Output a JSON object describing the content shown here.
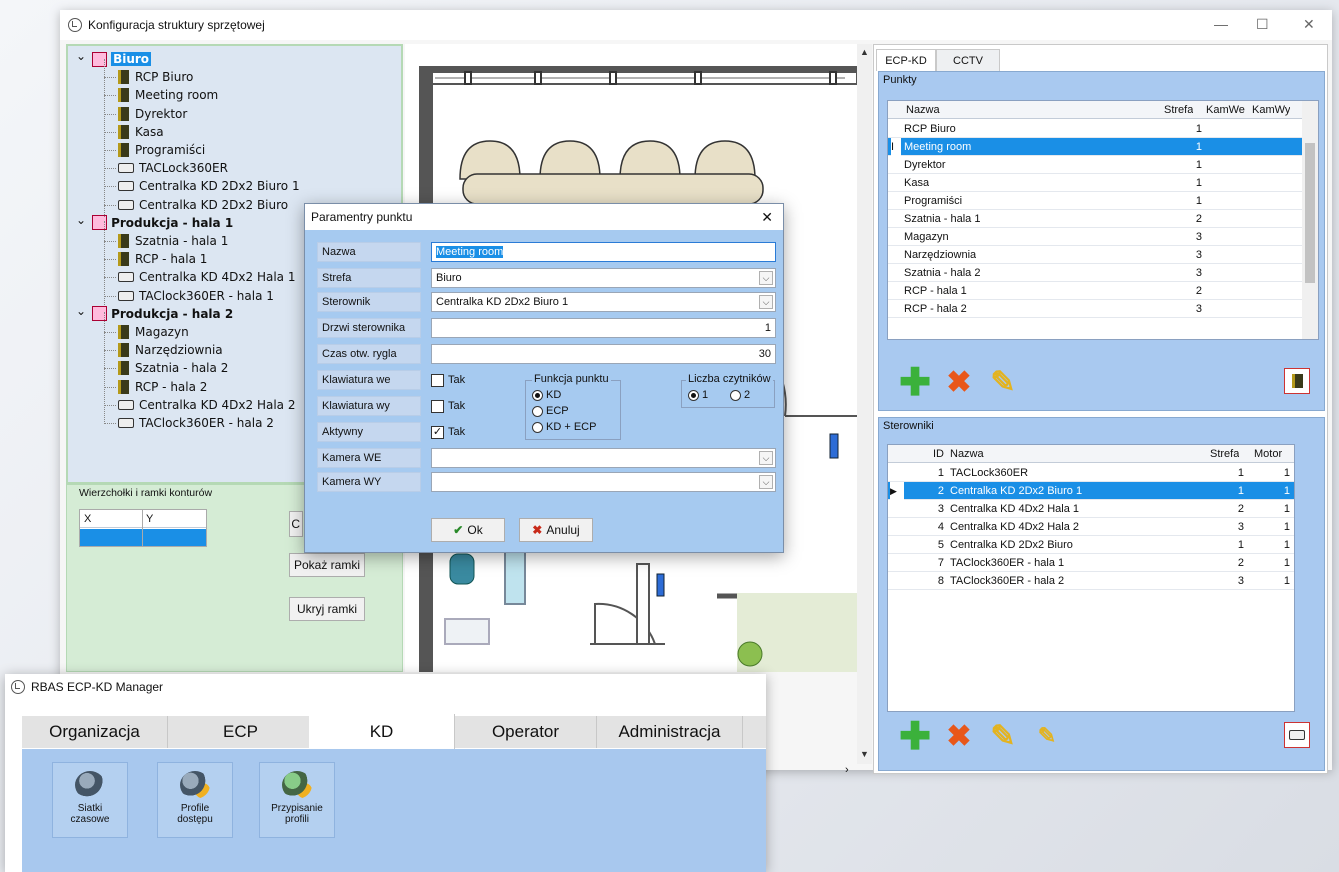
{
  "main_window": {
    "title": "Konfiguracja struktury sprzętowej",
    "min": "—",
    "max": "☐",
    "close": "✕"
  },
  "tree": [
    {
      "label": "Biuro",
      "type": "org",
      "level": 0,
      "selected": true
    },
    {
      "label": "RCP Biuro",
      "type": "door",
      "level": 1
    },
    {
      "label": "Meeting room",
      "type": "door",
      "level": 1
    },
    {
      "label": "Dyrektor",
      "type": "door",
      "level": 1
    },
    {
      "label": "Kasa",
      "type": "door",
      "level": 1
    },
    {
      "label": "Programiści",
      "type": "door",
      "level": 1
    },
    {
      "label": "TACLock360ER",
      "type": "dev",
      "level": 1
    },
    {
      "label": "Centralka KD 2Dx2 Biuro 1",
      "type": "dev",
      "level": 1
    },
    {
      "label": "Centralka KD 2Dx2 Biuro",
      "type": "dev",
      "level": 1
    },
    {
      "label": "Produkcja - hala 1",
      "type": "org",
      "level": 0
    },
    {
      "label": "Szatnia - hala 1",
      "type": "door",
      "level": 1
    },
    {
      "label": "RCP - hala 1",
      "type": "door",
      "level": 1
    },
    {
      "label": "Centralka KD 4Dx2 Hala 1",
      "type": "dev",
      "level": 1
    },
    {
      "label": "TAClock360ER - hala 1",
      "type": "dev",
      "level": 1
    },
    {
      "label": "Produkcja - hala 2",
      "type": "org",
      "level": 0
    },
    {
      "label": "Magazyn",
      "type": "door",
      "level": 1
    },
    {
      "label": "Narzędziownia",
      "type": "door",
      "level": 1
    },
    {
      "label": "Szatnia - hala 2",
      "type": "door",
      "level": 1
    },
    {
      "label": "RCP - hala 2",
      "type": "door",
      "level": 1
    },
    {
      "label": "Centralka KD 4Dx2 Hala 2",
      "type": "dev",
      "level": 1
    },
    {
      "label": "TAClock360ER - hala 2",
      "type": "dev",
      "level": 1
    }
  ],
  "contours": {
    "title": "Wierzchołki i ramki konturów",
    "col_x": "X",
    "col_y": "Y",
    "btn_partial": "C",
    "btn_show": "Pokaż ramki",
    "btn_hide": "Ukryj ramki"
  },
  "right_panel": {
    "tabs": [
      "ECP-KD",
      "CCTV"
    ],
    "punkty": {
      "title": "Punkty",
      "headers": [
        "Nazwa",
        "Strefa",
        "KamWe",
        "KamWy"
      ],
      "rows": [
        {
          "nazwa": "RCP Biuro",
          "strefa": "1"
        },
        {
          "nazwa": "Meeting room",
          "strefa": "1",
          "selected": true
        },
        {
          "nazwa": "Dyrektor",
          "strefa": "1"
        },
        {
          "nazwa": "Kasa",
          "strefa": "1"
        },
        {
          "nazwa": "Programiści",
          "strefa": "1"
        },
        {
          "nazwa": "Szatnia - hala 1",
          "strefa": "2"
        },
        {
          "nazwa": "Magazyn",
          "strefa": "3"
        },
        {
          "nazwa": "Narzędziownia",
          "strefa": "3"
        },
        {
          "nazwa": "Szatnia - hala 2",
          "strefa": "3"
        },
        {
          "nazwa": "RCP - hala 1",
          "strefa": "2"
        },
        {
          "nazwa": "RCP - hala 2",
          "strefa": "3"
        }
      ]
    },
    "sterowniki": {
      "title": "Sterowniki",
      "headers": [
        "ID",
        "Nazwa",
        "Strefa",
        "Motor"
      ],
      "rows": [
        {
          "id": "1",
          "nazwa": "TACLock360ER",
          "strefa": "1",
          "motor": "1"
        },
        {
          "id": "2",
          "nazwa": "Centralka KD 2Dx2 Biuro 1",
          "strefa": "1",
          "motor": "1",
          "selected": true
        },
        {
          "id": "3",
          "nazwa": "Centralka KD 4Dx2 Hala 1",
          "strefa": "2",
          "motor": "1"
        },
        {
          "id": "4",
          "nazwa": "Centralka KD 4Dx2 Hala 2",
          "strefa": "3",
          "motor": "1"
        },
        {
          "id": "5",
          "nazwa": "Centralka KD 2Dx2 Biuro",
          "strefa": "1",
          "motor": "1"
        },
        {
          "id": "7",
          "nazwa": "TAClock360ER - hala 1",
          "strefa": "2",
          "motor": "1"
        },
        {
          "id": "8",
          "nazwa": "TAClock360ER - hala 2",
          "strefa": "3",
          "motor": "1"
        }
      ]
    },
    "colors": {
      "add": "#3bb13b",
      "delete": "#e8571a",
      "edit": "#e3b320",
      "select": "#1a8fe6"
    }
  },
  "dialog": {
    "title": "Paramentry punktu",
    "close": "✕",
    "fields": {
      "nazwa_label": "Nazwa",
      "nazwa_value": "Meeting room",
      "strefa_label": "Strefa",
      "strefa_value": "Biuro",
      "sterownik_label": "Sterownik",
      "sterownik_value": "Centralka KD 2Dx2 Biuro 1",
      "drzwi_label": "Drzwi sterownika",
      "drzwi_value": "1",
      "czas_label": "Czas otw. rygla",
      "czas_value": "30",
      "klaw_we_label": "Klawiatura we",
      "klaw_wy_label": "Klawiatura wy",
      "aktywny_label": "Aktywny",
      "tak": "Tak",
      "kamera_we_label": "Kamera WE",
      "kamera_wy_label": "Kamera WY"
    },
    "funkcja": {
      "title": "Funkcja punktu",
      "options": [
        "KD",
        "ECP",
        "KD + ECP"
      ],
      "selected": "KD"
    },
    "czytniki": {
      "title": "Liczba czytników",
      "options": [
        "1",
        "2"
      ],
      "selected": "1"
    },
    "checks": {
      "klaw_we": false,
      "klaw_wy": false,
      "aktywny": true
    },
    "ok": "Ok",
    "cancel": "Anuluj"
  },
  "rbas": {
    "title": "RBAS ECP-KD Manager",
    "tabs": [
      "Organizacja",
      "ECP",
      "KD",
      "Operator",
      "Administracja"
    ],
    "active_tab": "KD",
    "buttons": [
      {
        "label1": "Siatki",
        "label2": "czasowe"
      },
      {
        "label1": "Profile",
        "label2": "dostępu"
      },
      {
        "label1": "Przypisanie",
        "label2": "profili"
      }
    ]
  }
}
